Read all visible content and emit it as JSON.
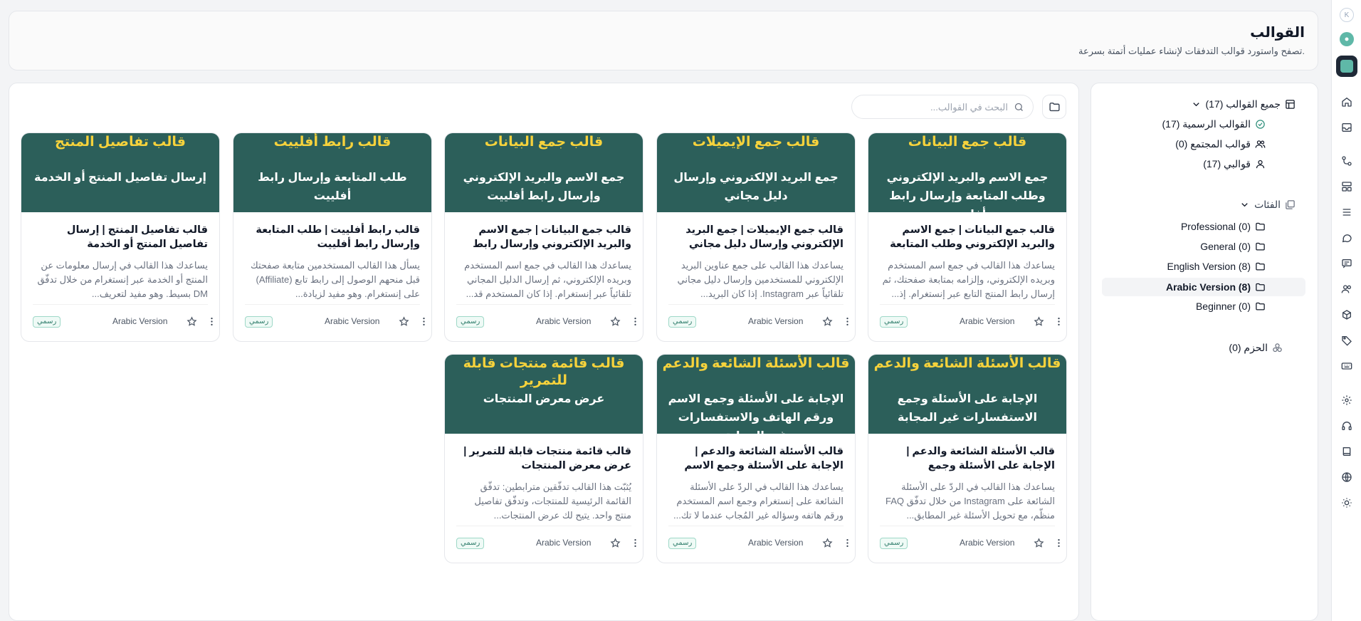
{
  "header": {
    "title": "القوالب",
    "subtitle": "تصفح واستورد قوالب التدفقات لإنشاء عمليات أتمتة بسرعة."
  },
  "search": {
    "placeholder": "البحث في القوالب..."
  },
  "sidebar": {
    "all_templates": "جميع القوالب (17)",
    "official": "القوالب الرسمية (17)",
    "community": "قوالب المجتمع (0)",
    "mine": "قوالبي (17)",
    "categories_label": "الفئات",
    "categories": [
      {
        "label": "Professional (0)"
      },
      {
        "label": "General (0)"
      },
      {
        "label": "English Version (8)"
      },
      {
        "label": "Arabic Version (8)"
      },
      {
        "label": "Beginner (0)"
      }
    ],
    "bundles": "الحزم (0)"
  },
  "cards": [
    {
      "banner_title": "قالب جمع البيانات",
      "banner_sub": "جمع الاسم والبريد الإلكتروني وطلب المتابعة وإرسال رابط أفلييت",
      "title": "قالب جمع البيانات | جمع الاسم والبريد الإلكتروني وطلب المتابعة وإرسال راب...",
      "desc": "يساعدك هذا القالب في جمع اسم المستخدم وبريده الإلكتروني، وإلزامه بمتابعة صفحتك، ثم إرسال رابط المنتج التابع عبر إنستغرام. إذ...",
      "version": "Arabic Version",
      "badge": "رسمي"
    },
    {
      "banner_title": "قالب جمع الإيميلات",
      "banner_sub": "جمع البريد الإلكتروني وإرسال دليل مجاني",
      "title": "قالب جمع الإيميلات | جمع البريد الإلكتروني وإرسال دليل مجاني",
      "desc": "يساعدك هذا القالب على جمع عناوين البريد الإلكتروني للمستخدمين وإرسال دليل مجاني تلقائياً عبر Instagram. إذا كان البريد...",
      "version": "Arabic Version",
      "badge": "رسمي"
    },
    {
      "banner_title": "قالب جمع البيانات",
      "banner_sub": "جمع الاسم والبريد الإلكتروني وإرسال رابط أفلييت",
      "title": "قالب جمع البيانات | جمع الاسم والبريد الإلكتروني وإرسال رابط أفلييت",
      "desc": "يساعدك هذا القالب في جمع اسم المستخدم وبريده الإلكتروني، ثم إرسال الدليل المجاني تلقائياً عبر إنستغرام. إذا كان المستخدم قد...",
      "version": "Arabic Version",
      "badge": "رسمي"
    },
    {
      "banner_title": "قالب رابط أفلييت",
      "banner_sub": "طلب المتابعة وإرسال رابط أفلييت",
      "title": "قالب رابط أفلييت | طلب المتابعة وإرسال رابط أفلييت",
      "desc": "يسأل هذا القالب المستخدمين متابعة صفحتك قبل منحهم الوصول إلى رابط تابع (Affiliate) على إنستغرام. وهو مفيد لزيادة...",
      "version": "Arabic Version",
      "badge": "رسمي"
    },
    {
      "banner_title": "قالب تفاصيل المنتج",
      "banner_sub": "إرسال تفاصيل المنتج أو الخدمة",
      "title": "قالب تفاصيل المنتج | إرسال تفاصيل المنتج أو الخدمة",
      "desc": "يساعدك هذا القالب في إرسال معلومات عن المنتج أو الخدمة عبر إنستغرام من خلال تدفّق DM بسيط. وهو مفيد لتعريف...",
      "version": "Arabic Version",
      "badge": "رسمي"
    },
    {
      "banner_title": "قالب الأسئلة الشائعة والدعم",
      "banner_sub": "الإجابة على الأسئلة وجمع الاستفسارات غير المجابة",
      "title": "قالب الأسئلة الشائعة والدعم | الإجابة على الأسئلة وجمع الاستفسارات غير...",
      "desc": "يساعدك هذا القالب في الردّ على الأسئلة الشائعة على Instagram من خلال تدفّق FAQ منظّم، مع تحويل الأسئلة غير المطابق...",
      "version": "Arabic Version",
      "badge": "رسمي"
    },
    {
      "banner_title": "قالب الأسئلة الشائعة والدعم",
      "banner_sub": "الإجابة على الأسئلة وجمع الاسم ورقم الهاتف والاستفسارات غير المجابة",
      "title": "قالب الأسئلة الشائعة والدعم | الإجابة على الأسئلة وجمع الاسم ورقم الهات...",
      "desc": "يساعدك هذا القالب في الردّ على الأسئلة الشائعة على إنستغرام وجمع اسم المستخدم ورقم هاتفه وسؤاله غير المُجاب عندما لا تك...",
      "version": "Arabic Version",
      "badge": "رسمي"
    },
    {
      "banner_title": "قالب قائمة منتجات قابلة للتمرير",
      "banner_sub": "عرض معرض المنتجات",
      "title": "قالب قائمة منتجات قابلة للتمرير | عرض معرض المنتجات",
      "desc": "يُثبّت هذا القالب تدفّقين مترابطين: تدفّق القائمة الرئيسية للمنتجات، وتدفّق تفاصيل منتج واحد. يتيح لك عرض المنتجات...",
      "version": "Arabic Version",
      "badge": "رسمي"
    }
  ]
}
